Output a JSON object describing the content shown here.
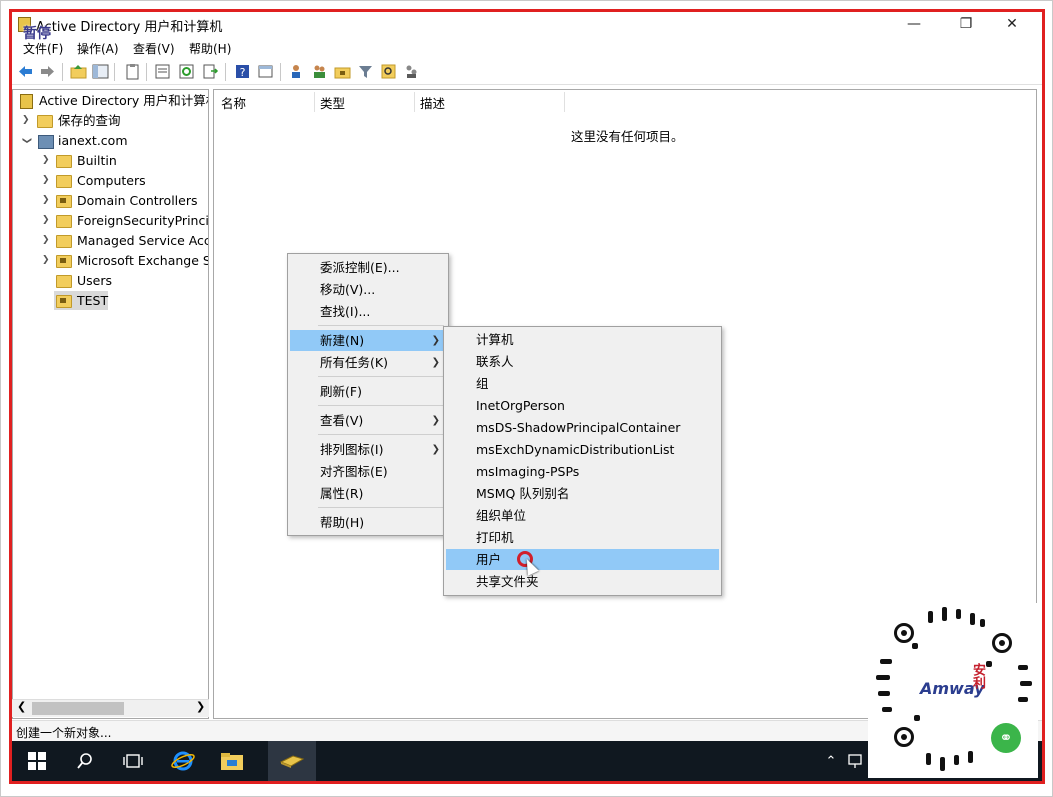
{
  "window": {
    "title": "Active Directory 用户和计算机",
    "pause_label": "暂停",
    "controls": {
      "minimize": "—",
      "maximize": "❐",
      "close": "✕"
    }
  },
  "menubar": [
    {
      "label": "文件(F)"
    },
    {
      "label": "操作(A)"
    },
    {
      "label": "查看(V)"
    },
    {
      "label": "帮助(H)"
    }
  ],
  "tree": {
    "root": "Active Directory 用户和计算机",
    "saved_queries": "保存的查询",
    "domain": "ianext.com",
    "children": [
      {
        "label": "Builtin",
        "type": "folder"
      },
      {
        "label": "Computers",
        "type": "folder"
      },
      {
        "label": "Domain Controllers",
        "type": "ou"
      },
      {
        "label": "ForeignSecurityPrincipa",
        "type": "folder"
      },
      {
        "label": "Managed Service Accc",
        "type": "folder"
      },
      {
        "label": "Microsoft Exchange Se",
        "type": "ou"
      },
      {
        "label": "Users",
        "type": "folder"
      },
      {
        "label": "TEST",
        "type": "ou",
        "selected": true
      }
    ]
  },
  "list": {
    "columns": [
      "名称",
      "类型",
      "描述"
    ],
    "empty_message": "这里没有任何项目。"
  },
  "context_menu": {
    "items": [
      {
        "label": "委派控制(E)..."
      },
      {
        "label": "移动(V)..."
      },
      {
        "label": "查找(I)..."
      },
      {
        "label": "新建(N)",
        "submenu": true,
        "highlighted": true
      },
      {
        "label": "所有任务(K)",
        "submenu": true
      },
      {
        "label": "刷新(F)"
      },
      {
        "label": "查看(V)",
        "submenu": true
      },
      {
        "label": "排列图标(I)",
        "submenu": true
      },
      {
        "label": "对齐图标(E)"
      },
      {
        "label": "属性(R)"
      },
      {
        "label": "帮助(H)"
      }
    ]
  },
  "new_submenu": {
    "items": [
      {
        "label": "计算机"
      },
      {
        "label": "联系人"
      },
      {
        "label": "组"
      },
      {
        "label": "InetOrgPerson"
      },
      {
        "label": "msDS-ShadowPrincipalContainer"
      },
      {
        "label": "msExchDynamicDistributionList"
      },
      {
        "label": "msImaging-PSPs"
      },
      {
        "label": "MSMQ 队列别名"
      },
      {
        "label": "组织单位"
      },
      {
        "label": "打印机"
      },
      {
        "label": "用户",
        "highlighted": true
      },
      {
        "label": "共享文件夹"
      }
    ]
  },
  "status": {
    "text": "创建一个新对象..."
  },
  "overlay": {
    "brand": "Amway",
    "red_mark": "安利"
  },
  "colors": {
    "highlight": "#91c9f7",
    "frame_red": "#e02020",
    "taskbar": "#101820"
  }
}
